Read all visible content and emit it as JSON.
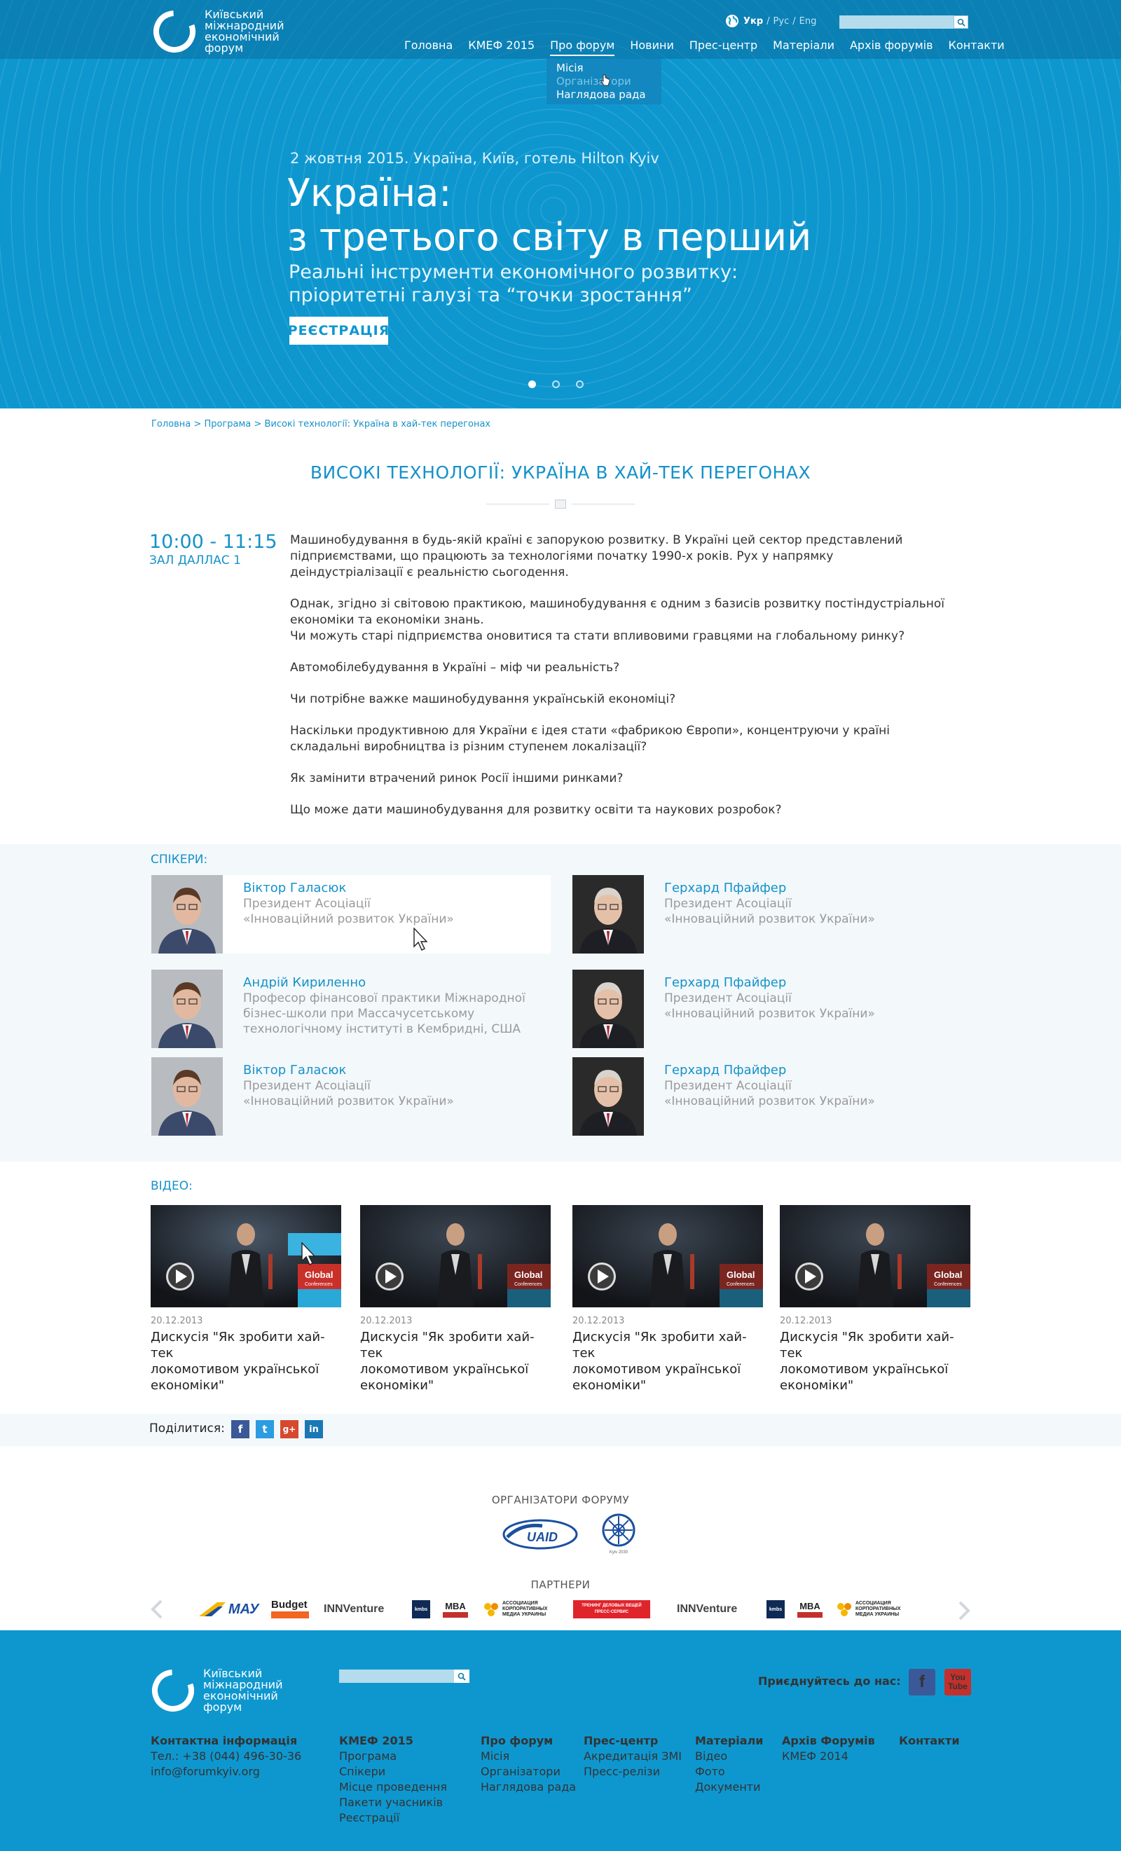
{
  "brand": {
    "logo_lines": [
      "Київський",
      "міжнародний",
      "економічний",
      "форум"
    ]
  },
  "lang": {
    "ukr": "Укр",
    "rus": "Рус",
    "eng": "Eng",
    "sep": "/"
  },
  "search": {
    "placeholder": ""
  },
  "nav": {
    "items": [
      "Головна",
      "КМЕФ 2015",
      "Про форум",
      "Новини",
      "Прес-центр",
      "Матеріали",
      "Архів форумів",
      "Контакти"
    ],
    "dropdown": [
      "Місія",
      "Організатори",
      "Наглядова рада"
    ]
  },
  "hero": {
    "date": "2 жовтня 2015. Україна, Київ, готель Hilton Kyiv",
    "title_line1": "Україна:",
    "title_line2": "з третього світу в перший",
    "sub_line1": "Реальні інструменти економічного розвитку:",
    "sub_line2": "пріоритетні галузі та “точки зростання”",
    "register": "РЕЄСТРАЦІЯ"
  },
  "breadcrumb": {
    "home": "Головна",
    "program": "Програма",
    "current": "Високі технології: Україна в хай-тек перегонах",
    "sep": ">"
  },
  "page": {
    "title": "ВИСОКІ ТЕХНОЛОГІЇ: УКРАЇНА В ХАЙ-ТЕК ПЕРЕГОНАХ",
    "time": "10:00 - 11:15",
    "hall": "ЗАЛ ДАЛЛАС 1",
    "paragraphs": [
      "Машинобудування в будь-якій країні є запорукою розвитку. В Україні цей сектор представлений підприємствами, що працюють за технологіями початку 1990-х років. Рух у напрямку деіндустріалізації є реальністю сьогодення.",
      "Однак, згідно зі світовою практикою, машинобудування є одним з базисів розвитку постіндустріальної економіки та економіки знань.\nЧи можуть старі підприємства оновитися та стати впливовими гравцями на глобальному ринку?",
      "Автомобілебудування в Україні – міф чи реальність?",
      "Чи потрібне важке машинобудування українській економіці?",
      "Наскільки продуктивною для України є ідея стати «фабрикою Європи», концентруючи у країні складальні виробництва із різним ступенем локалізації?",
      "Як замінити втрачений ринок Росії іншими ринками?",
      "Що може дати машинобудування для розвитку освіти та наукових розробок?"
    ]
  },
  "speakers": {
    "heading": "СПІКЕРИ:",
    "list": [
      {
        "name": "Віктор Галасюк",
        "role_lines": [
          "Президент Асоціації",
          "«Інноваційний розвиток України»"
        ]
      },
      {
        "name": "Герхард Пфайфер",
        "role_lines": [
          "Президент Асоціації",
          "«Інноваційний розвиток України»"
        ]
      },
      {
        "name": "Андрій Кириленно",
        "role_lines": [
          "Професор фінансової практики Міжнародної",
          "бізнес-школи при Массачусетському",
          "технологічному інституті в Кембридні, США"
        ]
      },
      {
        "name": "Герхард Пфайфер",
        "role_lines": [
          "Президент Асоціації",
          "«Інноваційний розвиток України»"
        ]
      },
      {
        "name": "Віктор Галасюк",
        "role_lines": [
          "Президент Асоціації",
          "«Інноваційний розвиток України»"
        ]
      },
      {
        "name": "Герхард Пфайфер",
        "role_lines": [
          "Президент Асоціації",
          "«Інноваційний розвиток України»"
        ]
      }
    ]
  },
  "videos": {
    "heading": "ВІДЕО:",
    "list": [
      {
        "date": "20.12.2013",
        "title_lines": [
          "Дискусія \"Як зробити хай-тек",
          "локомотивом української",
          "економіки\""
        ]
      },
      {
        "date": "20.12.2013",
        "title_lines": [
          "Дискусія \"Як зробити хай-тек",
          "локомотивом української",
          "економіки\""
        ]
      },
      {
        "date": "20.12.2013",
        "title_lines": [
          "Дискусія \"Як зробити хай-тек",
          "локомотивом української",
          "економіки\""
        ]
      },
      {
        "date": "20.12.2013",
        "title_lines": [
          "Дискусія \"Як зробити хай-тек",
          "локомотивом української",
          "економіки\""
        ]
      }
    ],
    "banner": [
      "Global",
      "Conferences"
    ]
  },
  "share": {
    "label": "Поділитися:",
    "icons": [
      "f",
      "t",
      "g+",
      "in"
    ]
  },
  "organizers": {
    "heading": "ОРГАНІЗАТОРИ ФОРУМУ",
    "uaid": "UAID",
    "kyiv": "Kyiv 2030"
  },
  "partners": {
    "heading": "ПАРТНЕРИ",
    "mau": "МАУ",
    "budget": "Budget",
    "innventure": "INNVenture",
    "kmbs": "kmbs",
    "mba": "MBA",
    "assoc": [
      "АССОЦИАЦИЯ",
      "КОРПОРАТИВНЫХ",
      "МЕДИА УКРАИНЫ"
    ],
    "red": [
      "ТРЕНИНГ ДЕЛОВЫХ ВЕЩЕЙ",
      "ПРЕСС-СЕРВИС"
    ]
  },
  "footer": {
    "join": "Приєднуйтесь до нас:",
    "fb": "f",
    "yt": [
      "You",
      "Tube"
    ],
    "contact_heading": "Контактна інформація",
    "phone": "Тел.: +38 (044) 496-30-36",
    "email": "info@forumkyiv.org",
    "cols": [
      {
        "heading": "КМЕФ 2015",
        "items": [
          "Програма",
          "Спікери",
          "Місце проведення",
          "Пакети учасників",
          "Реєстрації"
        ]
      },
      {
        "heading": "Про форум",
        "items": [
          "Місія",
          "Організатори",
          "Наглядова рада"
        ]
      },
      {
        "heading": "Прес-центр",
        "items": [
          "Акредитація ЗМІ",
          "Пресс-релізи"
        ]
      },
      {
        "heading": "Матеріали",
        "items": [
          "Відео",
          "Фото",
          "Документи"
        ]
      },
      {
        "heading": "Архів Форумів",
        "items": [
          "КМЕФ 2014"
        ]
      },
      {
        "heading": "Контакти",
        "items": []
      }
    ]
  },
  "colors": {
    "primary": "#0e97cf",
    "link": "#1592c9",
    "panel": "#f3f8fb",
    "facebook": "#3b5998",
    "youtube": "#c4302b"
  }
}
